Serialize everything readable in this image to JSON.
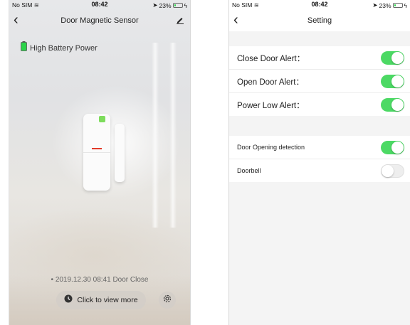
{
  "status_bar": {
    "carrier": "No SIM",
    "time": "08:42",
    "battery_text": "23%",
    "battery_level": 0.23
  },
  "sensor_screen": {
    "title": "Door Magnetic Sensor",
    "battery_status": "High Battery Power",
    "last_event": "2019.12.30 08:41 Door Close",
    "view_more_label": "Click to view more",
    "icons": [
      "back-icon",
      "edit-icon",
      "battery-icon",
      "clock-icon",
      "gear-icon"
    ]
  },
  "settings_screen": {
    "title": "Setting",
    "alerts": [
      {
        "label": "Close Door Alert：",
        "enabled": true
      },
      {
        "label": "Open Door Alert：",
        "enabled": true
      },
      {
        "label": "Power Low Alert：",
        "enabled": true
      }
    ],
    "features": [
      {
        "label": "Door Opening detection",
        "enabled": true
      },
      {
        "label": "Doorbell",
        "enabled": false
      }
    ]
  },
  "colors": {
    "toggle_on": "#4cd964",
    "battery_green": "#2bd44a",
    "sensor_led": "#7ddc5c",
    "sensor_line": "#e23b2a"
  }
}
